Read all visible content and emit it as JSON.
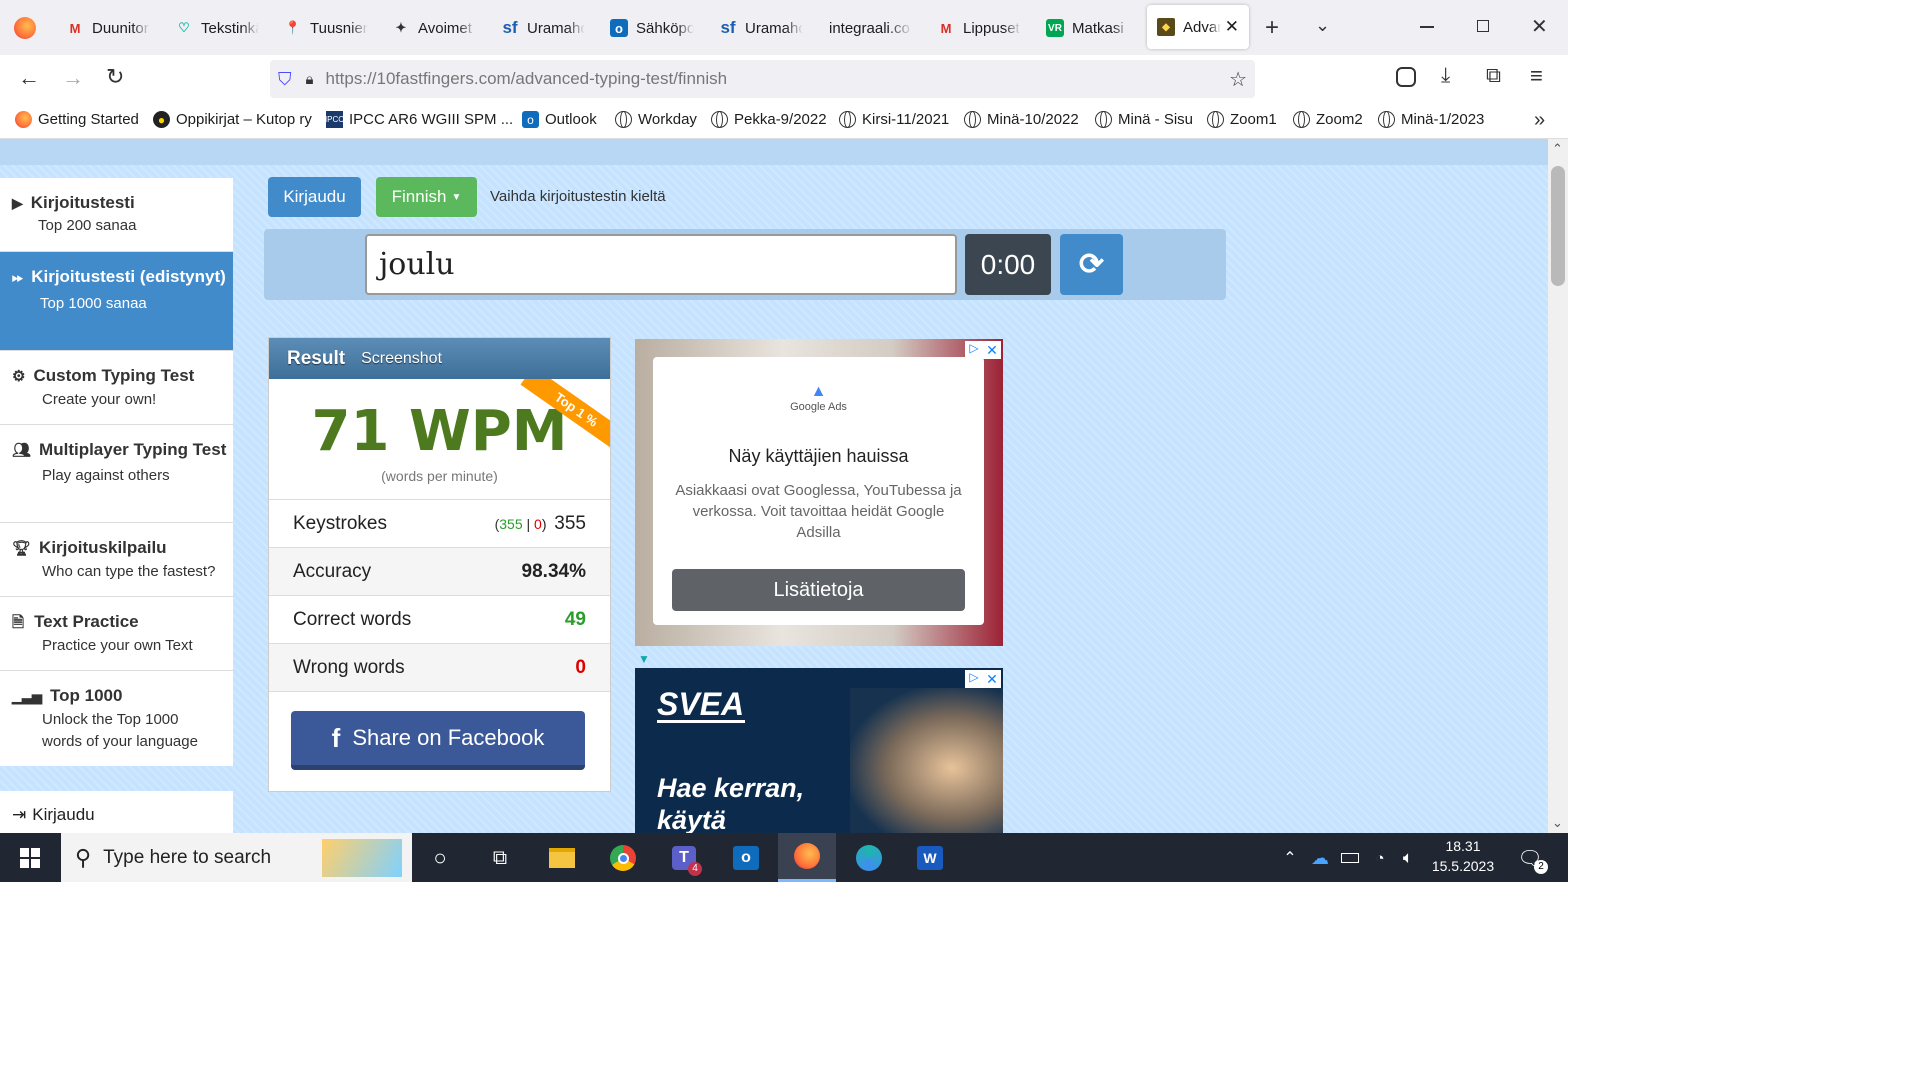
{
  "browser": {
    "tabs": [
      {
        "label": "Duunitor",
        "icon": "gmail-icon"
      },
      {
        "label": "Tekstinkä",
        "icon": "heart-icon"
      },
      {
        "label": "Tuusnien",
        "icon": "map-pin-icon"
      },
      {
        "label": "Avoimet",
        "icon": "bird-icon"
      },
      {
        "label": "Uramaho",
        "icon": "sf-icon"
      },
      {
        "label": "Sähköpo",
        "icon": "outlook-icon"
      },
      {
        "label": "Uramaho",
        "icon": "sf-icon"
      },
      {
        "label": "integraali.co",
        "icon": "none"
      },
      {
        "label": "Lippuset",
        "icon": "gmail-icon"
      },
      {
        "label": "Matkasi",
        "icon": "vr-icon"
      },
      {
        "label": "Advan",
        "icon": "site-icon"
      }
    ],
    "url_host": "https://10fastfingers.com",
    "url_path": "/advanced-typing-test/finnish",
    "bookmarks": [
      {
        "label": "Getting Started",
        "icon": "firefox-icon"
      },
      {
        "label": "Oppikirjat – Kutop ry",
        "icon": "site-icon"
      },
      {
        "label": "IPCC AR6 WGIII SPM ...",
        "icon": "ipcc-icon"
      },
      {
        "label": "Outlook",
        "icon": "outlook-icon"
      },
      {
        "label": "Workday",
        "icon": "globe-icon"
      },
      {
        "label": "Pekka-9/2022",
        "icon": "globe-icon"
      },
      {
        "label": "Kirsi-11/2021",
        "icon": "globe-icon"
      },
      {
        "label": "Minä-10/2022",
        "icon": "globe-icon"
      },
      {
        "label": "Minä - Sisu",
        "icon": "globe-icon"
      },
      {
        "label": "Zoom1",
        "icon": "globe-icon"
      },
      {
        "label": "Zoom2",
        "icon": "globe-icon"
      },
      {
        "label": "Minä-1/2023",
        "icon": "globe-icon"
      }
    ]
  },
  "sidebar": {
    "items": [
      {
        "title": "Kirjoitustesti",
        "subtitle": "Top 200 sanaa"
      },
      {
        "title": "Kirjoitustesti (edistynyt)",
        "subtitle": "Top 1000 sanaa"
      },
      {
        "title": "Custom Typing Test",
        "subtitle": "Create your own!"
      },
      {
        "title": "Multiplayer Typing Test",
        "subtitle": "Play against others"
      },
      {
        "title": "Kirjoituskilpailu",
        "subtitle": "Who can type the fastest?"
      },
      {
        "title": "Text Practice",
        "subtitle": "Practice your own Text"
      },
      {
        "title": "Top 1000",
        "subtitle": "Unlock the Top 1000 words of your language"
      }
    ],
    "login": "Kirjaudu"
  },
  "toolbar": {
    "login_button": "Kirjaudu",
    "language_button": "Finnish",
    "language_hint": "Vaihda kirjoitustestin kieltä"
  },
  "typing": {
    "word": "joulu",
    "timer": "0:00"
  },
  "result": {
    "tab_result": "Result",
    "tab_screenshot": "Screenshot",
    "ribbon": "Top 1 %",
    "wpm": "71 WPM",
    "wpm_caption": "(words per minute)",
    "keystrokes_label": "Keystrokes",
    "keystrokes_correct": "355",
    "keystrokes_sep": "|",
    "keystrokes_wrong": "0",
    "keystrokes_total": "355",
    "accuracy_label": "Accuracy",
    "accuracy_value": "98.34%",
    "correct_label": "Correct words",
    "correct_value": "49",
    "wrong_label": "Wrong words",
    "wrong_value": "0",
    "share_button": "Share on Facebook"
  },
  "ads": {
    "ad1_brand": "Google Ads",
    "ad1_title": "Näy käyttäjien hauissa",
    "ad1_body": "Asiakkaasi ovat Googlessa, YouTubessa ja verkossa. Voit tavoittaa heidät Google Adsilla",
    "ad1_cta": "Lisätietoja",
    "ad2_brand": "SVEA",
    "ad2_line1": "Hae kerran,",
    "ad2_line2": "käytä"
  },
  "taskbar": {
    "search_placeholder": "Type here to search",
    "time": "18.31",
    "date": "15.5.2023",
    "teams_badge": "4",
    "notification_count": "2"
  },
  "colors": {
    "accent_blue": "#428bca",
    "green": "#5cb85c",
    "wpm_green": "#4d7a1f",
    "page_bg": "#c5e3ff"
  }
}
